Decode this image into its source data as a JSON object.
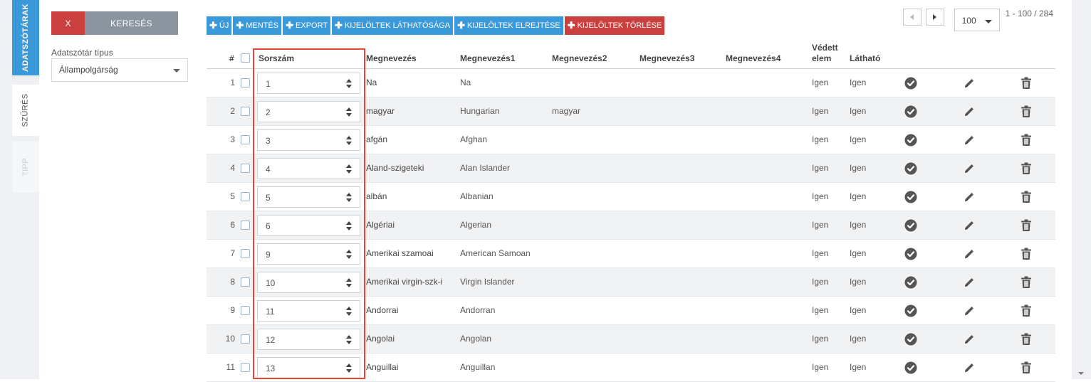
{
  "left_tabs": {
    "dictionaries": "ADATSZÓTÁRAK",
    "filter": "SZŰRÉS",
    "tip": "TIPP"
  },
  "filter_panel": {
    "clear_label": "X",
    "search_label": "KERESÉS",
    "type_label": "Adatszótár típus",
    "type_value": "Állampolgárság"
  },
  "toolbar": {
    "new": "ÚJ",
    "save": "MENTÉS",
    "export": "EXPORT",
    "show_selected": "KIJELÖLTEK LÁTHATÓSÁGA",
    "hide_selected": "KIJELÖLTEK ELREJTÉSE",
    "delete_selected": "KIJELÖLTEK TÖRLÉSE"
  },
  "pager": {
    "page_size": "100",
    "range": "1 - 100 / 284"
  },
  "columns": {
    "hash": "#",
    "order": "Sorszám",
    "name": "Megnevezés",
    "name1": "Megnevezés1",
    "name2": "Megnevezés2",
    "name3": "Megnevezés3",
    "name4": "Megnevezés4",
    "protected_1": "Védett",
    "protected_2": "elem",
    "visible": "Látható"
  },
  "rows": [
    {
      "n": "1",
      "order": "1",
      "name": "Na",
      "name1": "Na",
      "name2": "",
      "protected": "Igen",
      "visible": "Igen"
    },
    {
      "n": "2",
      "order": "2",
      "name": "magyar",
      "name1": "Hungarian",
      "name2": "magyar",
      "protected": "Igen",
      "visible": "Igen"
    },
    {
      "n": "3",
      "order": "3",
      "name": "afgán",
      "name1": "Afghan",
      "name2": "",
      "protected": "Igen",
      "visible": "Igen"
    },
    {
      "n": "4",
      "order": "4",
      "name": "Aland-szigeteki",
      "name1": "Alan Islander",
      "name2": "",
      "protected": "Igen",
      "visible": "Igen"
    },
    {
      "n": "5",
      "order": "5",
      "name": "albán",
      "name1": "Albanian",
      "name2": "",
      "protected": "Igen",
      "visible": "Igen"
    },
    {
      "n": "6",
      "order": "6",
      "name": "Algériai",
      "name1": "Algerian",
      "name2": "",
      "protected": "Igen",
      "visible": "Igen"
    },
    {
      "n": "7",
      "order": "9",
      "name": "Amerikai szamoai",
      "name1": "American Samoan",
      "name2": "",
      "protected": "Igen",
      "visible": "Igen"
    },
    {
      "n": "8",
      "order": "10",
      "name": "Amerikai virgin-szk-i",
      "name1": "Virgin Islander",
      "name2": "",
      "protected": "Igen",
      "visible": "Igen"
    },
    {
      "n": "9",
      "order": "11",
      "name": "Andorrai",
      "name1": "Andorran",
      "name2": "",
      "protected": "Igen",
      "visible": "Igen"
    },
    {
      "n": "10",
      "order": "12",
      "name": "Angolai",
      "name1": "Angolan",
      "name2": "",
      "protected": "Igen",
      "visible": "Igen"
    },
    {
      "n": "11",
      "order": "13",
      "name": "Anguillai",
      "name1": "Anguillan",
      "name2": "",
      "protected": "Igen",
      "visible": "Igen"
    }
  ],
  "icons": {
    "confirm": "check-circle-icon",
    "edit": "pencil-icon",
    "delete": "trash-icon"
  },
  "colors": {
    "primary": "#3a9ad9",
    "danger": "#c9403f",
    "highlight": "#e8443a",
    "icon": "#555555"
  }
}
